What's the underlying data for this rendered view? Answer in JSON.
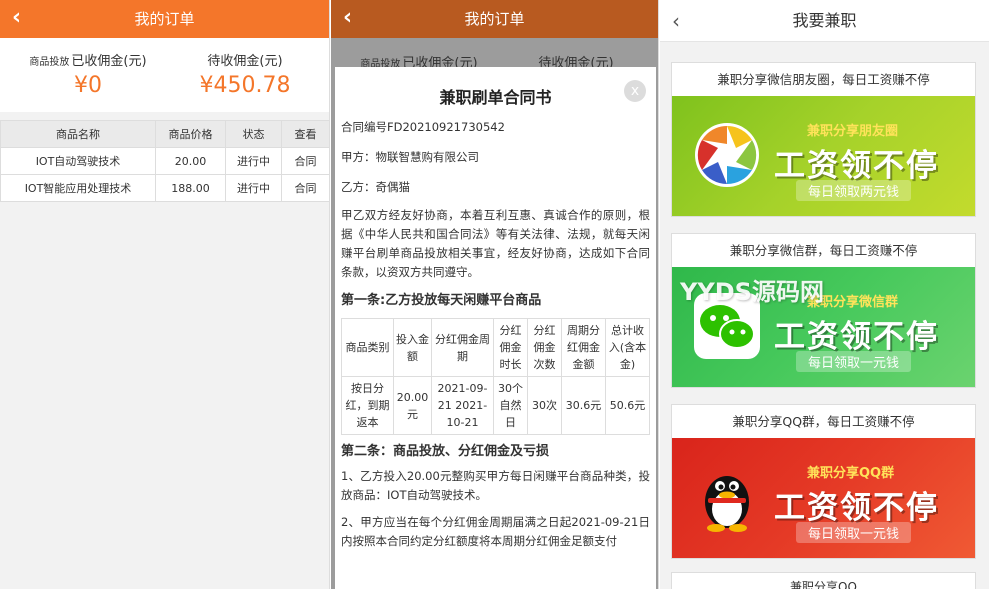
{
  "orders": {
    "title": "我的订单",
    "back": "‹",
    "summary": {
      "settled_small": "商品投放",
      "settled_label": "已收佣金(元)",
      "settled_value": "¥0",
      "pending_label": "待收佣金(元)",
      "pending_value": "¥450.78"
    },
    "table": {
      "headers": [
        "商品名称",
        "商品价格",
        "状态",
        "查看"
      ],
      "rows": [
        [
          "IOT自动驾驶技术",
          "20.00",
          "进行中",
          "合同"
        ],
        [
          "IOT智能应用处理技术",
          "188.00",
          "进行中",
          "合同"
        ]
      ]
    }
  },
  "contract": {
    "title": "兼职刷单合同书",
    "close": "x",
    "contract_no": "合同编号FD20210921730542",
    "party_a": "甲方：物联智慧购有限公司",
    "party_b": "乙方：奇偶猫",
    "intro": "甲乙双方经友好协商，本着互利互惠、真诚合作的原则，根据《中华人民共和国合同法》等有关法律、法规，就每天闲赚平台刷单商品投放相关事宜，经友好协商，达成如下合同条款，以资双方共同遵守。",
    "sec1": "第一条:乙方投放每天闲赚平台商品",
    "table": {
      "headers": [
        "商品类别",
        "投入金额",
        "分红佣金周期",
        "分红佣金时长",
        "分红佣金次数",
        "周期分红佣金金额",
        "总计收入(含本金)"
      ],
      "row": [
        "按日分红，到期返本",
        "20.00元",
        "2021-09-21 2021-10-21",
        "30个自然日",
        "30次",
        "30.6元",
        "50.6元"
      ]
    },
    "sec2": "第二条：商品投放、分红佣金及亏损",
    "p1": "1、乙方投入20.00元整购买甲方每日闲赚平台商品种类，投放商品：IOT自动驾驶技术。",
    "p2": "2、甲方应当在每个分红佣金周期届满之日起2021-09-21日内按照本合同约定分红额度将本周期分红佣金足额支付"
  },
  "jobs": {
    "title": "我要兼职",
    "back": "‹",
    "watermark": "YYDS源码网",
    "cards": [
      {
        "title": "兼职分享微信朋友圈，每日工资赚不停",
        "sub": "兼职分享朋友圈",
        "main": "工资领不停",
        "pill": "每日领取两元钱",
        "icon": "camera-aperture-icon"
      },
      {
        "title": "兼职分享微信群，每日工资赚不停",
        "sub": "兼职分享微信群",
        "main": "工资领不停",
        "pill": "每日领取一元钱",
        "icon": "wechat-icon"
      },
      {
        "title": "兼职分享QQ群，每日工资赚不停",
        "sub": "兼职分享QQ群",
        "main": "工资领不停",
        "pill": "每日领取一元钱",
        "icon": "qq-penguin-icon"
      }
    ],
    "peek_title": "兼职分享QQ"
  },
  "colors": {
    "orange": "#f4762a",
    "green1": "#7fc21d",
    "green2": "#2fb84a",
    "red": "#d9241b"
  }
}
